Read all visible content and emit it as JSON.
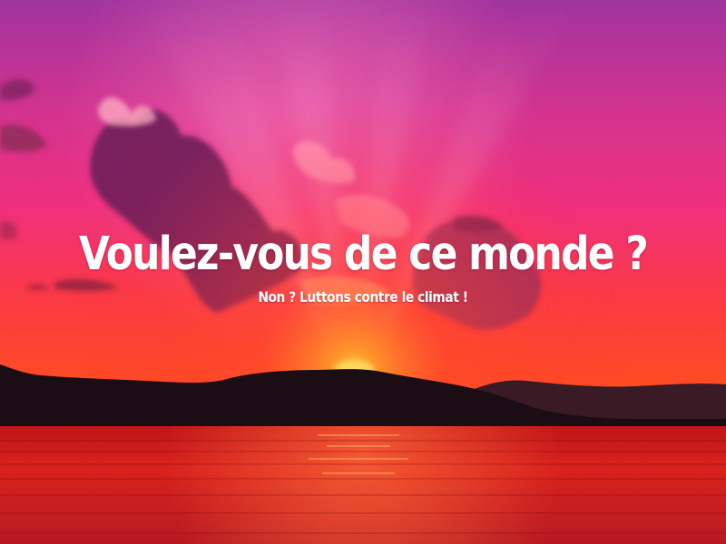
{
  "poster": {
    "headline": "Voulez-vous de ce monde ?",
    "subline": "Non ? Luttons contre le climat !"
  },
  "colors": {
    "sky_top": "#a0339e",
    "sky_mid": "#ef2f7e",
    "sky_low": "#fb3a45",
    "horizon": "#ff5a14",
    "sun": "#ffc23a",
    "mountains": "#1a0d14",
    "water": "#d0201c",
    "text": "#ffffff"
  }
}
